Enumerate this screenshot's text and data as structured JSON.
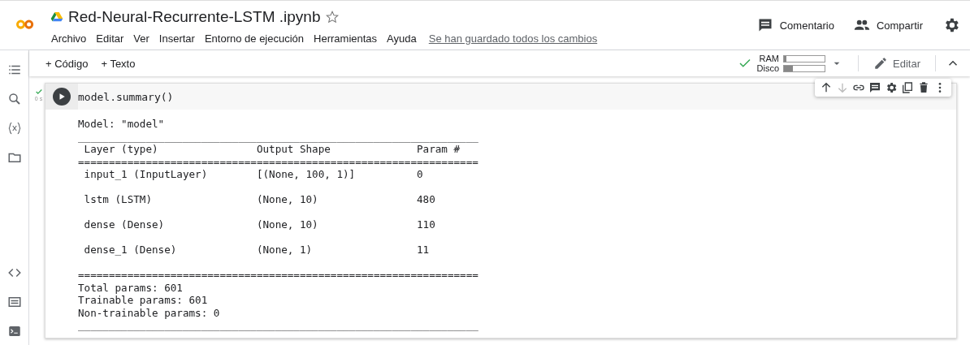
{
  "header": {
    "title": "Red-Neural-Recurrente-LSTM .ipynb",
    "starred": false,
    "menu": [
      "Archivo",
      "Editar",
      "Ver",
      "Insertar",
      "Entorno de ejecución",
      "Herramientas",
      "Ayuda"
    ],
    "save_status": "Se han guardado todos los cambios",
    "actions": [
      {
        "kind": "comment",
        "label": "Comentario"
      },
      {
        "kind": "share",
        "label": "Compartir"
      },
      {
        "kind": "settings"
      }
    ]
  },
  "toolbar": {
    "add": [
      {
        "label": "+ Código"
      },
      {
        "label": "+ Texto"
      }
    ],
    "resources": {
      "connected": true,
      "meters": [
        {
          "label": "RAM",
          "level": 0.06
        },
        {
          "label": "Disco",
          "level": 0.22
        }
      ]
    },
    "edit": "Editar"
  },
  "sidebar": {
    "top": [
      {
        "kind": "toc"
      },
      {
        "kind": "search"
      },
      {
        "kind": "variables"
      },
      {
        "kind": "files"
      }
    ],
    "bottom": [
      {
        "kind": "code"
      },
      {
        "kind": "command"
      },
      {
        "kind": "terminal"
      }
    ]
  },
  "cell": {
    "status_ok": true,
    "time": "0 s",
    "code": "model.summary()",
    "cell_tools": [
      {
        "kind": "up",
        "disabled": false
      },
      {
        "kind": "down",
        "disabled": true
      },
      {
        "kind": "link",
        "disabled": false
      },
      {
        "kind": "comment",
        "disabled": false
      },
      {
        "kind": "settings",
        "disabled": false
      },
      {
        "kind": "mirror",
        "disabled": false
      },
      {
        "kind": "delete",
        "disabled": false
      },
      {
        "kind": "more",
        "disabled": false
      }
    ],
    "output": "Model: \"model\"\n_________________________________________________________________\n Layer (type)                Output Shape              Param #\n=================================================================\n input_1 (InputLayer)        [(None, 100, 1)]          0\n\n lstm (LSTM)                 (None, 10)                480\n\n dense (Dense)               (None, 10)                110\n\n dense_1 (Dense)             (None, 1)                 11\n\n=================================================================\nTotal params: 601\nTrainable params: 601\nNon-trainable params: 0\n_________________________________________________________________"
  }
}
